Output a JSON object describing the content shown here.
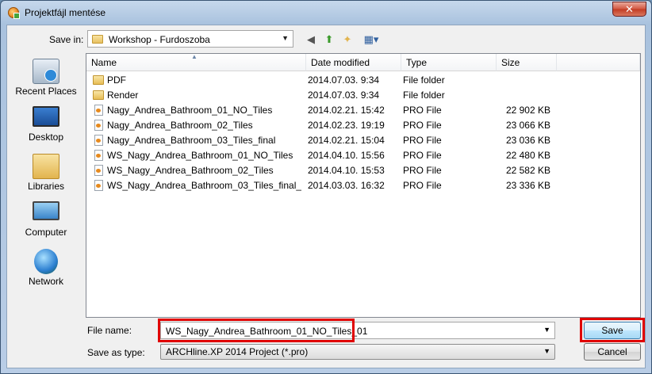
{
  "window": {
    "title": "Projektfájl mentése",
    "close_glyph": "✕"
  },
  "toolbar": {
    "save_in_label": "Save in:",
    "location": "Workshop - Furdoszoba",
    "icons": [
      "back-icon",
      "up-folder-icon",
      "new-folder-icon",
      "views-menu-icon"
    ]
  },
  "places": [
    {
      "label": "Recent Places",
      "icon": "recent-places-icon"
    },
    {
      "label": "Desktop",
      "icon": "desktop-icon"
    },
    {
      "label": "Libraries",
      "icon": "libraries-icon"
    },
    {
      "label": "Computer",
      "icon": "computer-icon"
    },
    {
      "label": "Network",
      "icon": "network-icon"
    }
  ],
  "columns": {
    "name": "Name",
    "date": "Date modified",
    "type": "Type",
    "size": "Size"
  },
  "files": [
    {
      "name": "PDF",
      "date": "2014.07.03. 9:34",
      "type": "File folder",
      "size": "",
      "kind": "folder"
    },
    {
      "name": "Render",
      "date": "2014.07.03. 9:34",
      "type": "File folder",
      "size": "",
      "kind": "folder"
    },
    {
      "name": "Nagy_Andrea_Bathroom_01_NO_Tiles",
      "date": "2014.02.21. 15:42",
      "type": "PRO File",
      "size": "22 902 KB",
      "kind": "file"
    },
    {
      "name": "Nagy_Andrea_Bathroom_02_Tiles",
      "date": "2014.02.23. 19:19",
      "type": "PRO File",
      "size": "23 066 KB",
      "kind": "file"
    },
    {
      "name": "Nagy_Andrea_Bathroom_03_Tiles_final",
      "date": "2014.02.21. 15:04",
      "type": "PRO File",
      "size": "23 036 KB",
      "kind": "file"
    },
    {
      "name": "WS_Nagy_Andrea_Bathroom_01_NO_Tiles",
      "date": "2014.04.10. 15:56",
      "type": "PRO File",
      "size": "22 480 KB",
      "kind": "file"
    },
    {
      "name": "WS_Nagy_Andrea_Bathroom_02_Tiles",
      "date": "2014.04.10. 15:53",
      "type": "PRO File",
      "size": "22 582 KB",
      "kind": "file"
    },
    {
      "name": "WS_Nagy_Andrea_Bathroom_03_Tiles_final_...",
      "date": "2014.03.03. 16:32",
      "type": "PRO File",
      "size": "23 336 KB",
      "kind": "file"
    }
  ],
  "form": {
    "file_name_label": "File name:",
    "file_name_value": "WS_Nagy_Andrea_Bathroom_01_NO_Tiles_01",
    "save_type_label": "Save as type:",
    "save_type_value": "ARCHline.XP 2014 Project (*.pro)"
  },
  "buttons": {
    "save": "Save",
    "cancel": "Cancel"
  },
  "colors": {
    "highlight": "#e00000"
  }
}
